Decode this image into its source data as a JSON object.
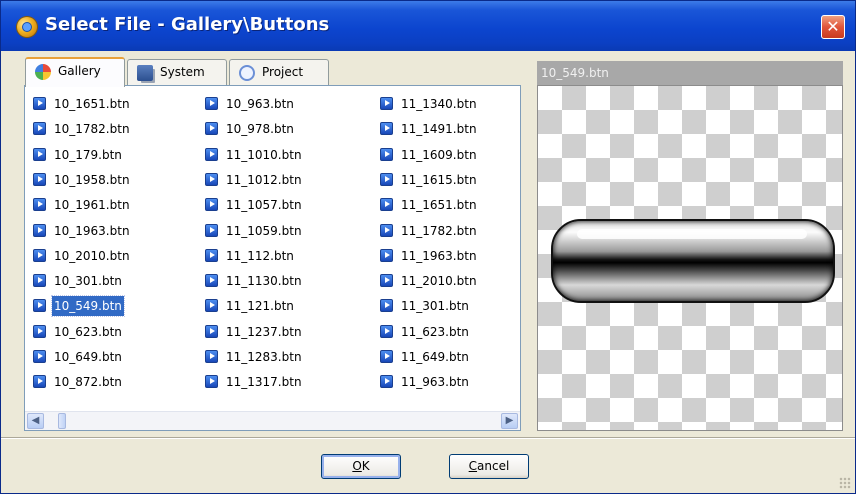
{
  "window": {
    "title": "Select File - Gallery\\Buttons",
    "close_symbol": "✕"
  },
  "tabs": [
    {
      "label": "Gallery",
      "icon": "gallery-icon",
      "active": true
    },
    {
      "label": "System",
      "icon": "system-icon",
      "active": false
    },
    {
      "label": "Project",
      "icon": "project-icon",
      "active": false
    }
  ],
  "file_list": {
    "columns": [
      [
        "10_1651.btn",
        "10_1782.btn",
        "10_179.btn",
        "10_1958.btn",
        "10_1961.btn",
        "10_1963.btn",
        "10_2010.btn",
        "10_301.btn",
        "10_549.btn",
        "10_623.btn",
        "10_649.btn",
        "10_872.btn"
      ],
      [
        "10_963.btn",
        "10_978.btn",
        "11_1010.btn",
        "11_1012.btn",
        "11_1057.btn",
        "11_1059.btn",
        "11_112.btn",
        "11_1130.btn",
        "11_121.btn",
        "11_1237.btn",
        "11_1283.btn",
        "11_1317.btn"
      ],
      [
        "11_1340.btn",
        "11_1491.btn",
        "11_1609.btn",
        "11_1615.btn",
        "11_1651.btn",
        "11_1782.btn",
        "11_1963.btn",
        "11_2010.btn",
        "11_301.btn",
        "11_623.btn",
        "11_649.btn",
        "11_963.btn"
      ]
    ],
    "selected": "10_549.btn"
  },
  "scrollbar": {
    "left_arrow": "◀",
    "right_arrow": "▶"
  },
  "preview": {
    "filename": "10_549.btn"
  },
  "buttons": {
    "ok": {
      "mnemonic": "O",
      "rest": "K"
    },
    "cancel": {
      "mnemonic": "C",
      "rest": "ancel"
    }
  }
}
